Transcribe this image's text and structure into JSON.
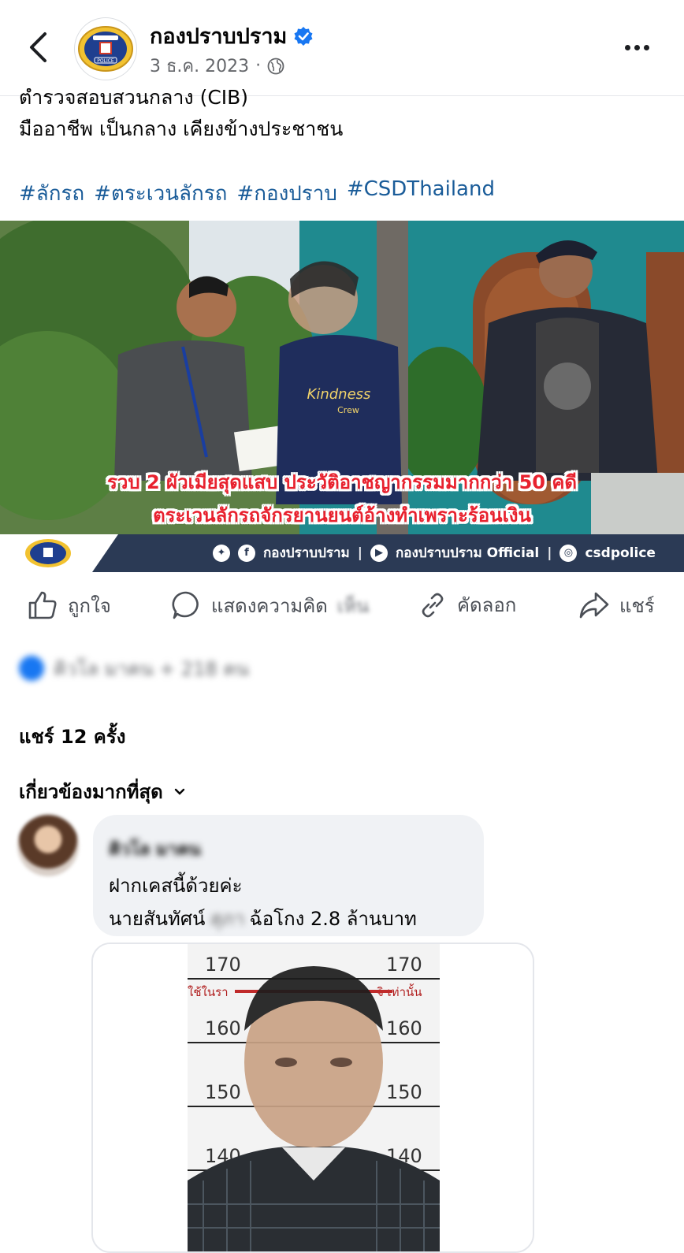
{
  "header": {
    "page_name": "กองปราบปราม",
    "date": "3 ธ.ค. 2023",
    "dot": "·",
    "logo_text": "POLICE"
  },
  "post": {
    "line_cut": "ตำรวจสอบสวนกลาง (CIB)",
    "line2": "มืออาชีพ เป็นกลาง เคียงข้างประชาชน",
    "hashtags": [
      "#ลักรถ",
      "#ตระเวนลักรถ",
      " #กองปราบ",
      "#CSDThailand"
    ]
  },
  "photo": {
    "overlay_line1": "รวบ 2 ผัวเมียสุดแสบ ประวัติอาชญากรรมมากกว่า 50 คดี",
    "overlay_line2": "ตระเวนลักรถจักรยานยนต์อ้างทำเพราะร้อนเงิน",
    "shirt_text": "Kindness",
    "shirt_text2": "Crew",
    "footer_fb": "กองปราบปราม",
    "footer_yt": "กองปราบปราม Official",
    "footer_ig": "csdpolice",
    "footer_sep": "|"
  },
  "actions": {
    "like": "ถูกใจ",
    "comment": "แสดงความคิด",
    "comment_blur": "เห็น",
    "copy": "คัดลอก",
    "share": "แชร์"
  },
  "reactions": {
    "text": "คิวโล มาคน + 218 คน"
  },
  "shares": "แชร์ 12 ครั้ง",
  "sort": "เกี่ยวข้องมากที่สุด",
  "comment": {
    "name": "คิวโล มาคน",
    "line1": "ฝากเคสนี้ด้วยค่ะ",
    "line2_a": "นายสันทัศน์",
    "line2_redact": "สุภา",
    "line2_b": "ฉ้อโกง 2.8 ล้านบาท",
    "mugshot": {
      "marks_left": [
        "170",
        "160",
        "150",
        "140"
      ],
      "marks_right": [
        "170",
        "160",
        "150",
        "140"
      ],
      "red_text_left": "ใช้ในรา",
      "red_text_right": "จิ เท่านั้น"
    }
  },
  "colors": {
    "link": "#1a5c99",
    "verified": "#1877f2",
    "overlay_red": "#e8212e",
    "footer_band": "#2b3a55"
  }
}
